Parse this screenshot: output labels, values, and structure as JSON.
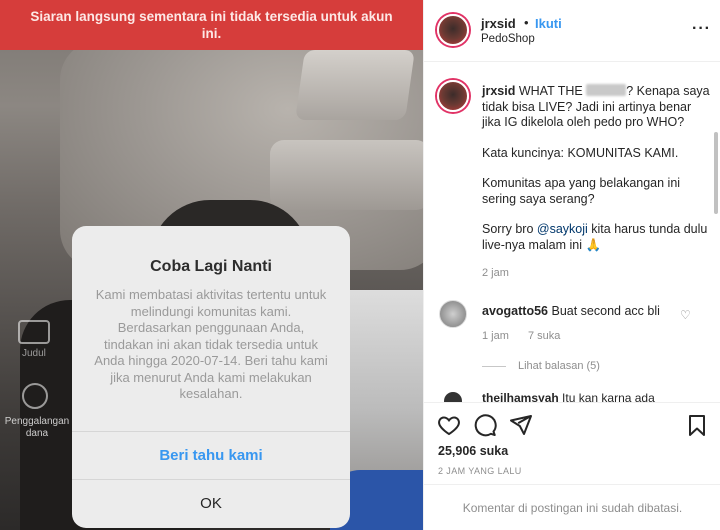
{
  "banner": {
    "text": "Siaran langsung sementara ini tidak tersedia untuk akun ini."
  },
  "side": {
    "label_1": "Judul",
    "label_2": "Penggalangan dana"
  },
  "dialog": {
    "title": "Coba Lagi Nanti",
    "body": "Kami membatasi aktivitas tertentu untuk melindungi komunitas kami. Berdasarkan penggunaan Anda, tindakan ini akan tidak tersedia untuk Anda hingga 2020-07-14. Beri tahu kami jika menurut Anda kami melakukan kesalahan.",
    "primary_label": "Beri tahu kami",
    "ok_label": "OK",
    "primary_color": "#3897f0"
  },
  "post": {
    "username": "jrxsid",
    "dot": "•",
    "follow_label": "Ikuti",
    "location": "PedoShop",
    "more_icon": "more-dots-icon",
    "caption_user": "jrxsid",
    "caption_p1_a": "WHAT THE",
    "caption_p1_b": "? Kenapa saya tidak bisa LIVE? Jadi ini artinya benar jika IG dikelola oleh pedo pro WHO?",
    "caption_p2": "Kata kuncinya: KOMUNITAS KAMI.",
    "caption_p3": "Komunitas apa yang belakangan ini sering saya serang?",
    "caption_p4_a": "Sorry bro",
    "caption_mention": "@saykoji",
    "caption_p4_b": "kita harus tunda dulu live-nya malam ini 🙏",
    "caption_time": "2 jam",
    "likes": "25,906 suka",
    "posted": "2 JAM YANG LALU",
    "comments_disabled": "Komentar di postingan ini sudah dibatasi."
  },
  "comments": [
    {
      "user": "avogatto56",
      "text": "Buat second acc bli",
      "time": "1 jam",
      "likes": "7 suka",
      "replies": "Lihat balasan (5)"
    },
    {
      "user": "theilhamsyah",
      "text": "Itu kan karna ada"
    }
  ],
  "colors": {
    "banner": "#d63d3b",
    "link": "#3897f0",
    "mention": "#00376b"
  }
}
